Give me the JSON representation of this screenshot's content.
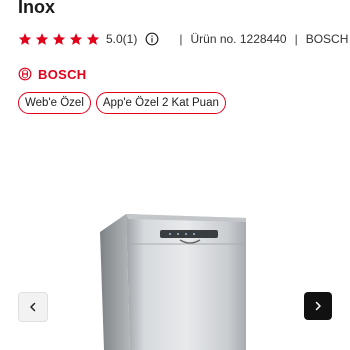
{
  "product": {
    "title": "Inox",
    "rating_text": "5.0(1)",
    "product_no": "Ürün no. 1228440",
    "brand_short": "BOSCH",
    "brand_logo_text": "BOSCH",
    "stars_count": 5,
    "star_color": "#e2001a"
  },
  "badges": [
    {
      "label": "Web'e Özel"
    },
    {
      "label": "App'e Özel 2 Kat Puan"
    }
  ],
  "gallery": {
    "prev_icon": "chevron-left-icon",
    "next_icon": "chevron-right-icon"
  },
  "colors": {
    "accent": "#e2001a",
    "text": "#222222"
  }
}
